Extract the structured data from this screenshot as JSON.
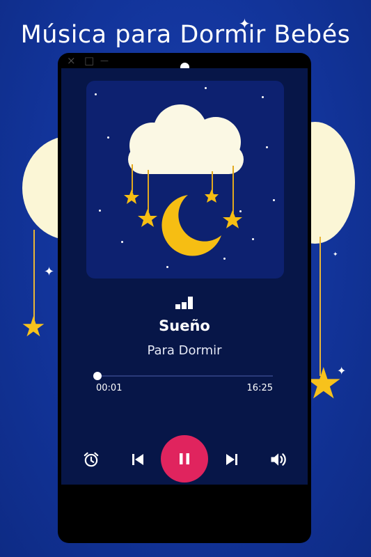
{
  "headline": "Música para Dormir Bebés",
  "window_controls": {
    "close_icon": "×",
    "restore_icon": "□",
    "minimize_icon": "—"
  },
  "player": {
    "artwork_icon": "cloud-moon-stars-illustration",
    "now_playing_icon": "equalizer-icon",
    "song_title": "Sueño",
    "song_artist": "Para Dormir",
    "current_time": "00:01",
    "total_time": "16:25",
    "progress": 0.001
  },
  "controls": {
    "alarm_icon": "alarm-clock-icon",
    "previous_icon": "skip-previous-icon",
    "play_pause_icon": "pause-icon",
    "next_icon": "skip-next-icon",
    "volume_icon": "volume-icon"
  },
  "colors": {
    "background": "#12349a",
    "screen": "#071648",
    "artwork": "#0d2170",
    "accent": "#e0245e",
    "moon": "#fbf6d6",
    "star": "#f7c21c"
  }
}
